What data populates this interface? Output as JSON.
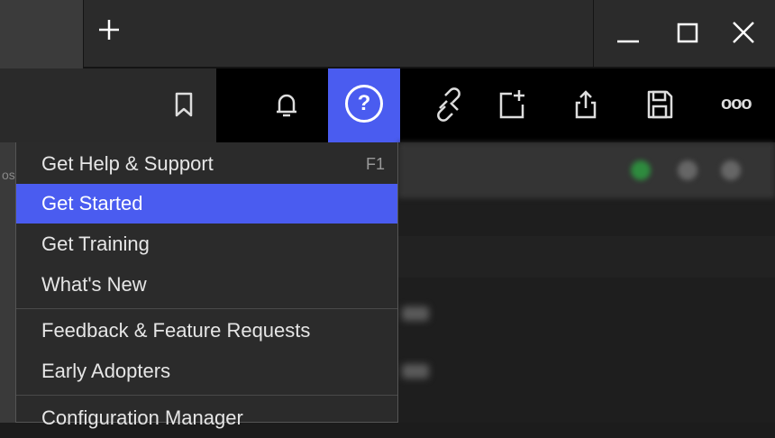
{
  "window": {
    "new_tab_icon": "plus-icon",
    "controls": [
      "minimize-icon",
      "maximize-icon",
      "close-icon"
    ]
  },
  "toolbar": {
    "icons": [
      "bookmark-icon",
      "bell-icon",
      "help-icon",
      "link-icon",
      "new-page-icon",
      "share-icon",
      "save-icon",
      "more-icon"
    ],
    "help_glyph": "?",
    "more_glyph": "ooo",
    "accent": "#4a5cf0"
  },
  "help_menu": {
    "items": [
      {
        "label": "Get Help & Support",
        "shortcut": "F1"
      },
      {
        "label": "Get Started",
        "highlighted": true
      },
      {
        "label": "Get Training"
      },
      {
        "label": "What's New"
      },
      {
        "label": "Feedback & Feature Requests"
      },
      {
        "label": "Early Adopters"
      },
      {
        "label": "Configuration Manager"
      }
    ]
  },
  "background": {
    "left_edge_text": "os"
  }
}
